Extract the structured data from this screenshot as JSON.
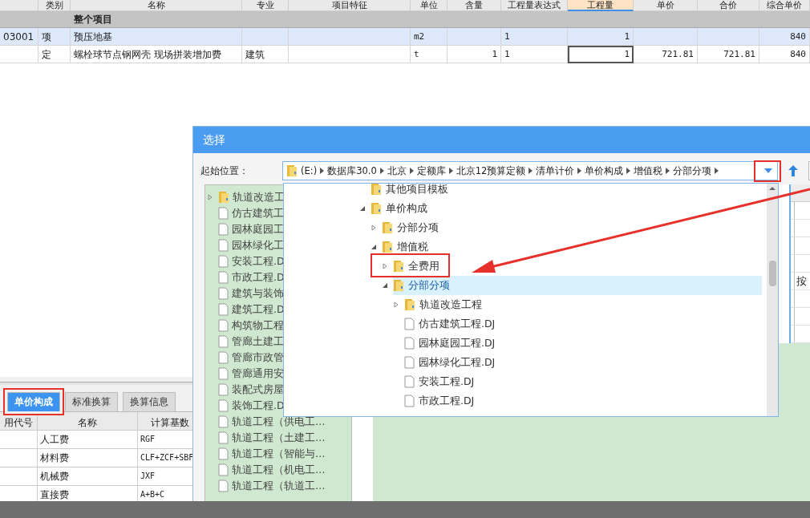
{
  "main_table": {
    "columns": [
      {
        "selected": false
      },
      {
        "label": "类别",
        "selected": false
      },
      {
        "label": "名称",
        "selected": false
      },
      {
        "label": "专业",
        "selected": false
      },
      {
        "label": "项目特征",
        "selected": false
      },
      {
        "label": "单位",
        "selected": false
      },
      {
        "label": "含量",
        "selected": false
      },
      {
        "label": "工程量表达式",
        "selected": false
      },
      {
        "label": "工程量",
        "selected": true
      },
      {
        "label": "单价",
        "selected": false
      },
      {
        "label": "合价",
        "selected": false
      },
      {
        "label": "综合单价",
        "selected": false
      }
    ],
    "group": {
      "label": "整个项目"
    },
    "rows": [
      {
        "selected": true,
        "editing": false,
        "cells": [
          "03001",
          "项",
          "预压地基",
          "",
          "",
          "m2",
          "",
          "1",
          "1",
          "",
          "",
          "840"
        ]
      },
      {
        "selected": false,
        "editing": true,
        "cells": [
          "",
          "定",
          "螺栓球节点钢网壳 现场拼装增加费",
          "建筑",
          "",
          "t",
          "1",
          "1",
          "1",
          "721.81",
          "721.81",
          "840"
        ]
      }
    ]
  },
  "bottom_panel": {
    "tabs": [
      {
        "label": "单价构成",
        "selected": true
      },
      {
        "label": "标准换算",
        "selected": false
      },
      {
        "label": "换算信息",
        "selected": false
      }
    ],
    "columns": [
      "用代号",
      "名称",
      "计算基数"
    ],
    "rows": [
      [
        "",
        "人工费",
        "RGF"
      ],
      [
        "",
        "材料费",
        "CLF+ZCF+SBF"
      ],
      [
        "",
        "机械费",
        "JXF"
      ],
      [
        "",
        "直接费",
        "A+B+C"
      ]
    ]
  },
  "dialog": {
    "title": "选择",
    "location_label": "起始位置：",
    "breadcrumb": [
      "(E:)",
      "数据库30.0",
      "北京",
      "定额库",
      "北京12预算定额",
      "清单计价",
      "单价构成",
      "增值税",
      "分部分项"
    ],
    "left_tree": [
      {
        "kind": "folder",
        "label": "轨道改造工"
      },
      {
        "kind": "file",
        "label": "仿古建筑工"
      },
      {
        "kind": "file",
        "label": "园林庭园工"
      },
      {
        "kind": "file",
        "label": "园林绿化工"
      },
      {
        "kind": "file",
        "label": "安装工程.D"
      },
      {
        "kind": "file",
        "label": "市政工程.D"
      },
      {
        "kind": "file",
        "label": "建筑与装饰"
      },
      {
        "kind": "file",
        "label": "建筑工程.D"
      },
      {
        "kind": "file",
        "label": "构筑物工程"
      },
      {
        "kind": "file",
        "label": "管廊土建工"
      },
      {
        "kind": "file",
        "label": "管廊市政管"
      },
      {
        "kind": "file",
        "label": "管廊通用安"
      },
      {
        "kind": "file",
        "label": "装配式房屋"
      },
      {
        "kind": "file",
        "label": "装饰工程.D"
      },
      {
        "kind": "file",
        "label": "轨道工程（供电工…"
      },
      {
        "kind": "file",
        "label": "轨道工程（土建工…"
      },
      {
        "kind": "file",
        "label": "轨道工程（智能与…"
      },
      {
        "kind": "file",
        "label": "轨道工程（机电工…"
      },
      {
        "kind": "file",
        "label": "轨道工程（轨道工…"
      }
    ],
    "partial_grid": {
      "text": "按"
    },
    "popup_tree": [
      {
        "kind": "leaf-folder",
        "label": "其他项目模板",
        "selected": false
      },
      {
        "kind": "folder",
        "label": "单价构成",
        "expanded": true,
        "selected": false,
        "children": [
          {
            "kind": "folder",
            "label": "分部分项",
            "expanded": false,
            "selected": false
          },
          {
            "kind": "folder",
            "label": "增值税",
            "expanded": true,
            "selected": false,
            "children": [
              {
                "kind": "folder",
                "label": "全费用",
                "expanded": false,
                "selected": false
              },
              {
                "kind": "folder",
                "label": "分部分项",
                "expanded": true,
                "selected": true,
                "children": [
                  {
                    "kind": "folder",
                    "label": "轨道改造工程",
                    "expanded": false,
                    "selected": false
                  },
                  {
                    "kind": "file",
                    "label": "仿古建筑工程.DJ",
                    "selected": false
                  },
                  {
                    "kind": "file",
                    "label": "园林庭园工程.DJ",
                    "selected": false
                  },
                  {
                    "kind": "file",
                    "label": "园林绿化工程.DJ",
                    "selected": false
                  },
                  {
                    "kind": "file",
                    "label": "安装工程.DJ",
                    "selected": false
                  },
                  {
                    "kind": "file",
                    "label": "市政工程.DJ",
                    "selected": false
                  }
                ]
              }
            ]
          }
        ]
      }
    ]
  }
}
